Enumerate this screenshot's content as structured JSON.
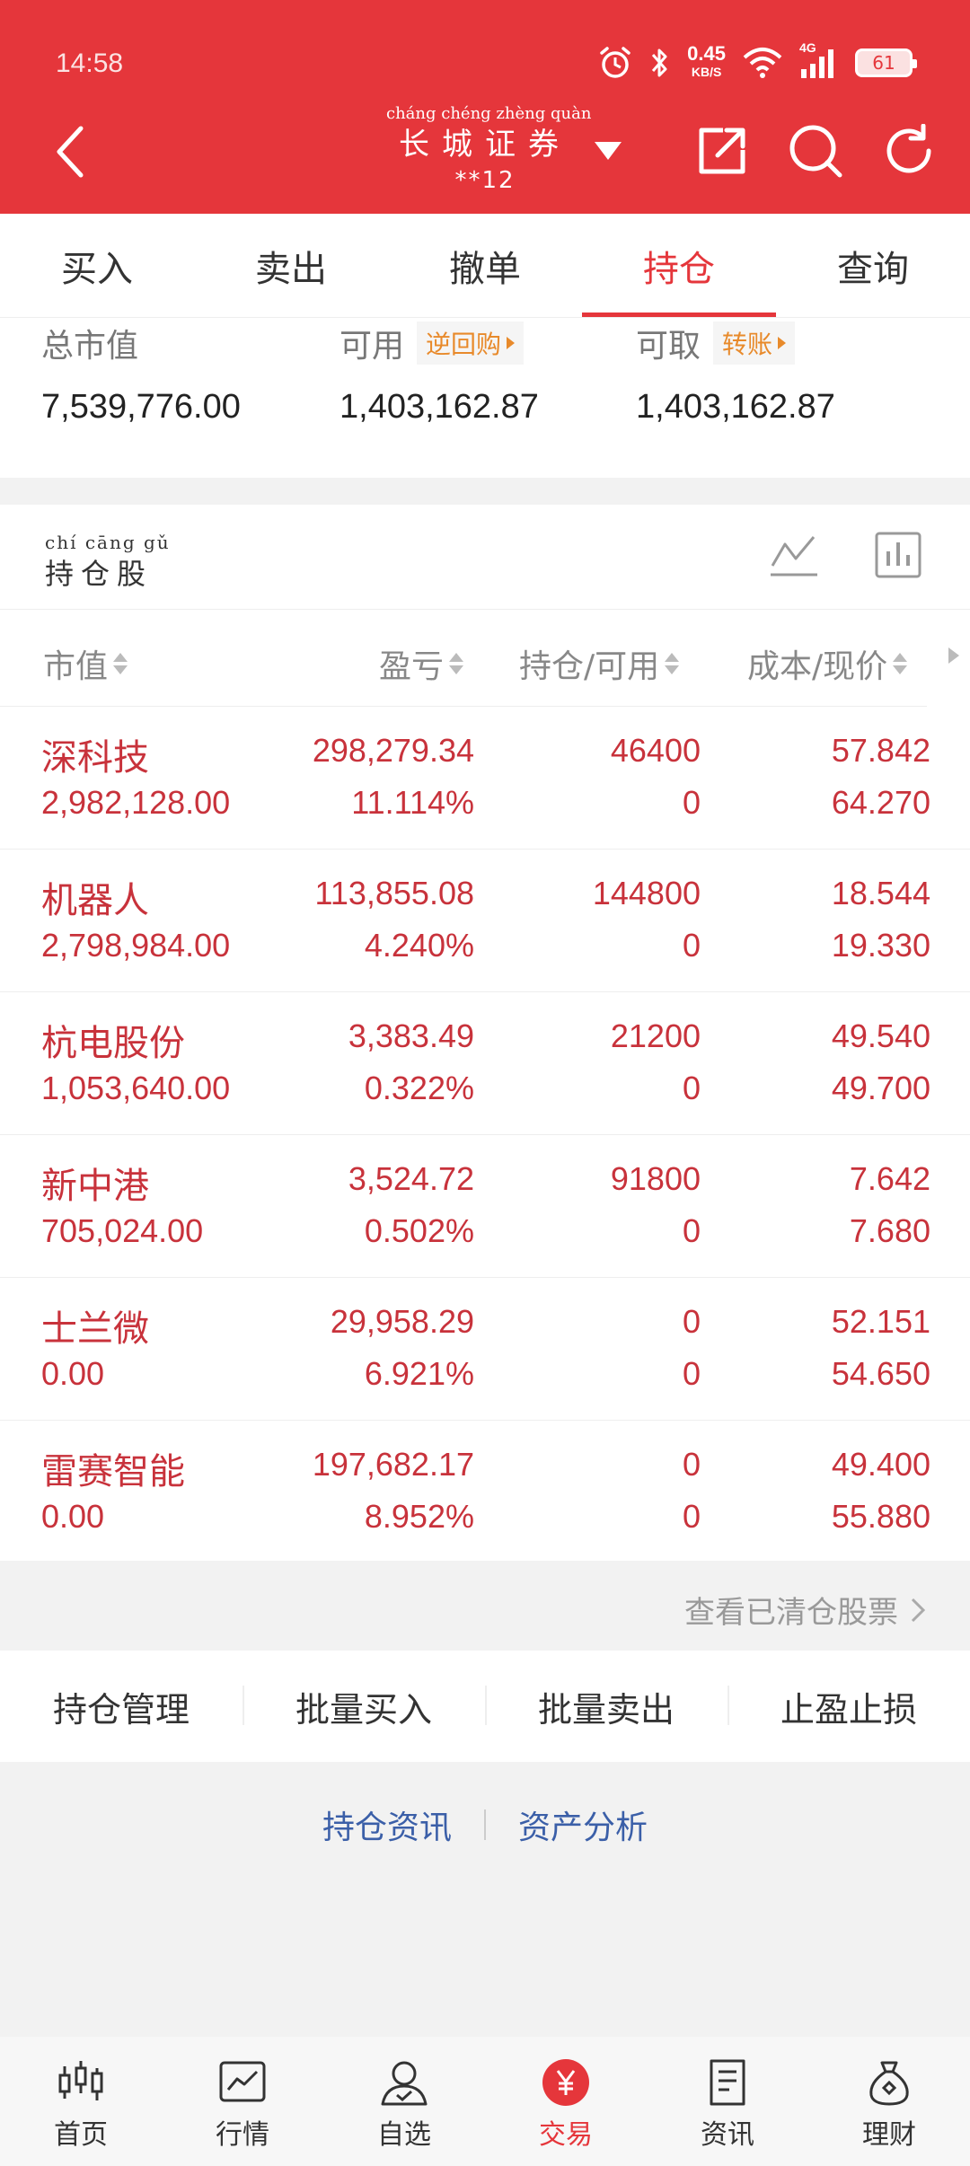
{
  "status_bar": {
    "time": "14:58",
    "net_speed": "0.45",
    "net_unit": "KB/S",
    "network": "4G",
    "battery": "61"
  },
  "header": {
    "broker_pinyin": "cháng chéng zhèng quàn",
    "broker_name": "长城证券",
    "account": "**12",
    "icons": [
      "back-icon",
      "dropdown-icon",
      "share-icon",
      "search-icon",
      "refresh-icon"
    ]
  },
  "tabs": [
    {
      "label": "买入",
      "active": false
    },
    {
      "label": "卖出",
      "active": false
    },
    {
      "label": "撤单",
      "active": false
    },
    {
      "label": "持仓",
      "active": true
    },
    {
      "label": "查询",
      "active": false
    }
  ],
  "summary": {
    "total_label": "总市值",
    "total_value": "7,539,776.00",
    "available_label": "可用",
    "available_tag": "逆回购",
    "available_value": "1,403,162.87",
    "withdraw_label": "可取",
    "withdraw_tag": "转账",
    "withdraw_value": "1,403,162.87"
  },
  "holdings": {
    "title_pinyin": "chí cāng gǔ",
    "title": "持仓股",
    "columns": [
      "市值",
      "盈亏",
      "持仓/可用",
      "成本/现价"
    ],
    "rows": [
      {
        "name": "深科技",
        "market_value": "2,982,128.00",
        "pnl": "298,279.34",
        "pnl_pct": "11.114%",
        "position": "46400",
        "available": "0",
        "cost": "57.842",
        "price": "64.270"
      },
      {
        "name": "机器人",
        "market_value": "2,798,984.00",
        "pnl": "113,855.08",
        "pnl_pct": "4.240%",
        "position": "144800",
        "available": "0",
        "cost": "18.544",
        "price": "19.330"
      },
      {
        "name": "杭电股份",
        "market_value": "1,053,640.00",
        "pnl": "3,383.49",
        "pnl_pct": "0.322%",
        "position": "21200",
        "available": "0",
        "cost": "49.540",
        "price": "49.700"
      },
      {
        "name": "新中港",
        "market_value": "705,024.00",
        "pnl": "3,524.72",
        "pnl_pct": "0.502%",
        "position": "91800",
        "available": "0",
        "cost": "7.642",
        "price": "7.680"
      },
      {
        "name": "士兰微",
        "market_value": "0.00",
        "pnl": "29,958.29",
        "pnl_pct": "6.921%",
        "position": "0",
        "available": "0",
        "cost": "52.151",
        "price": "54.650"
      },
      {
        "name": "雷赛智能",
        "market_value": "0.00",
        "pnl": "197,682.17",
        "pnl_pct": "8.952%",
        "position": "0",
        "available": "0",
        "cost": "49.400",
        "price": "55.880"
      }
    ]
  },
  "cleared_link": "查看已清仓股票",
  "actions": [
    "持仓管理",
    "批量买入",
    "批量卖出",
    "止盈止损"
  ],
  "links": [
    "持仓资讯",
    "资产分析"
  ],
  "bottom_nav": [
    {
      "label": "首页",
      "icon": "candlestick-icon",
      "active": false
    },
    {
      "label": "行情",
      "icon": "chart-line-icon",
      "active": false
    },
    {
      "label": "自选",
      "icon": "user-check-icon",
      "active": false
    },
    {
      "label": "交易",
      "icon": "yen-coin-icon",
      "active": true
    },
    {
      "label": "资讯",
      "icon": "document-icon",
      "active": false
    },
    {
      "label": "理财",
      "icon": "money-bag-icon",
      "active": false
    }
  ],
  "colors": {
    "brand_red": "#e5363b",
    "value_red": "#c8323b",
    "link_blue": "#3b5fa8",
    "tag_orange": "#e88a2b"
  }
}
